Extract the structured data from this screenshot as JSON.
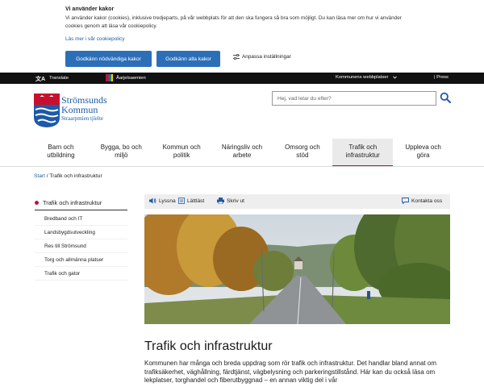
{
  "cookie": {
    "title": "Vi använder kakor",
    "text": "Vi använder kakor (cookies), inklusive tredjeparts, på vår webbplats för att den ska fungera så bra som möjligt. Du kan läsa mer om hur vi använder cookies genom att läsa vår cookiepolicy.",
    "link": "Läs mer i vår cookiepolicy",
    "btn_necessary": "Godkänn nödvändiga kakor",
    "btn_all": "Godkänn alla kakor",
    "settings": "Anpassa inställningar"
  },
  "topbar": {
    "translate": "Translate",
    "sami": "Åarjelsaemien",
    "sites": "Kommunens webbplatser",
    "press": "Press"
  },
  "header": {
    "logo_line1": "Strömsunds",
    "logo_line2": "Kommun",
    "logo_line3": "Straarpmien tjïelte",
    "search_placeholder": "Hej, vad letar du efter?"
  },
  "nav": {
    "items": [
      {
        "line1": "Barn och",
        "line2": "utbildning"
      },
      {
        "line1": "Bygga, bo och",
        "line2": "miljö"
      },
      {
        "line1": "Kommun och",
        "line2": "politik"
      },
      {
        "line1": "Näringsliv och",
        "line2": "arbete"
      },
      {
        "line1": "Omsorg och",
        "line2": "stöd"
      },
      {
        "line1": "Trafik och",
        "line2": "infrastruktur"
      },
      {
        "line1": "Uppleva och",
        "line2": "göra"
      }
    ]
  },
  "breadcrumb": {
    "home": "Start",
    "separator": " / ",
    "current": "Trafik och infrastruktur"
  },
  "sidebar": {
    "heading": "Trafik och infrastruktur",
    "items": [
      "Bredband och IT",
      "Landsbygdsutveckling",
      "Res till Strömsund",
      "Torg och allmänna platser",
      "Trafik och gator"
    ]
  },
  "tools": {
    "listen": "Lyssna",
    "easy_read": "Lättläst",
    "print": "Skriv ut",
    "contact": "Kontakta oss"
  },
  "article": {
    "title": "Trafik och infrastruktur",
    "body": "Kommunen har många och breda uppdrag som rör trafik och infrastruktur. Det handlar bland annat om trafiksäkerhet, väghållning, färdtjänst, vägbelysning och parkeringstillstånd. Här kan du också läsa om lekplatser, torghandel och fiberutbyggnad – en annan viktig del i vår"
  },
  "colors": {
    "accent_blue": "#2c6fb8",
    "accent_red": "#c0152e",
    "topbar": "#111111"
  }
}
